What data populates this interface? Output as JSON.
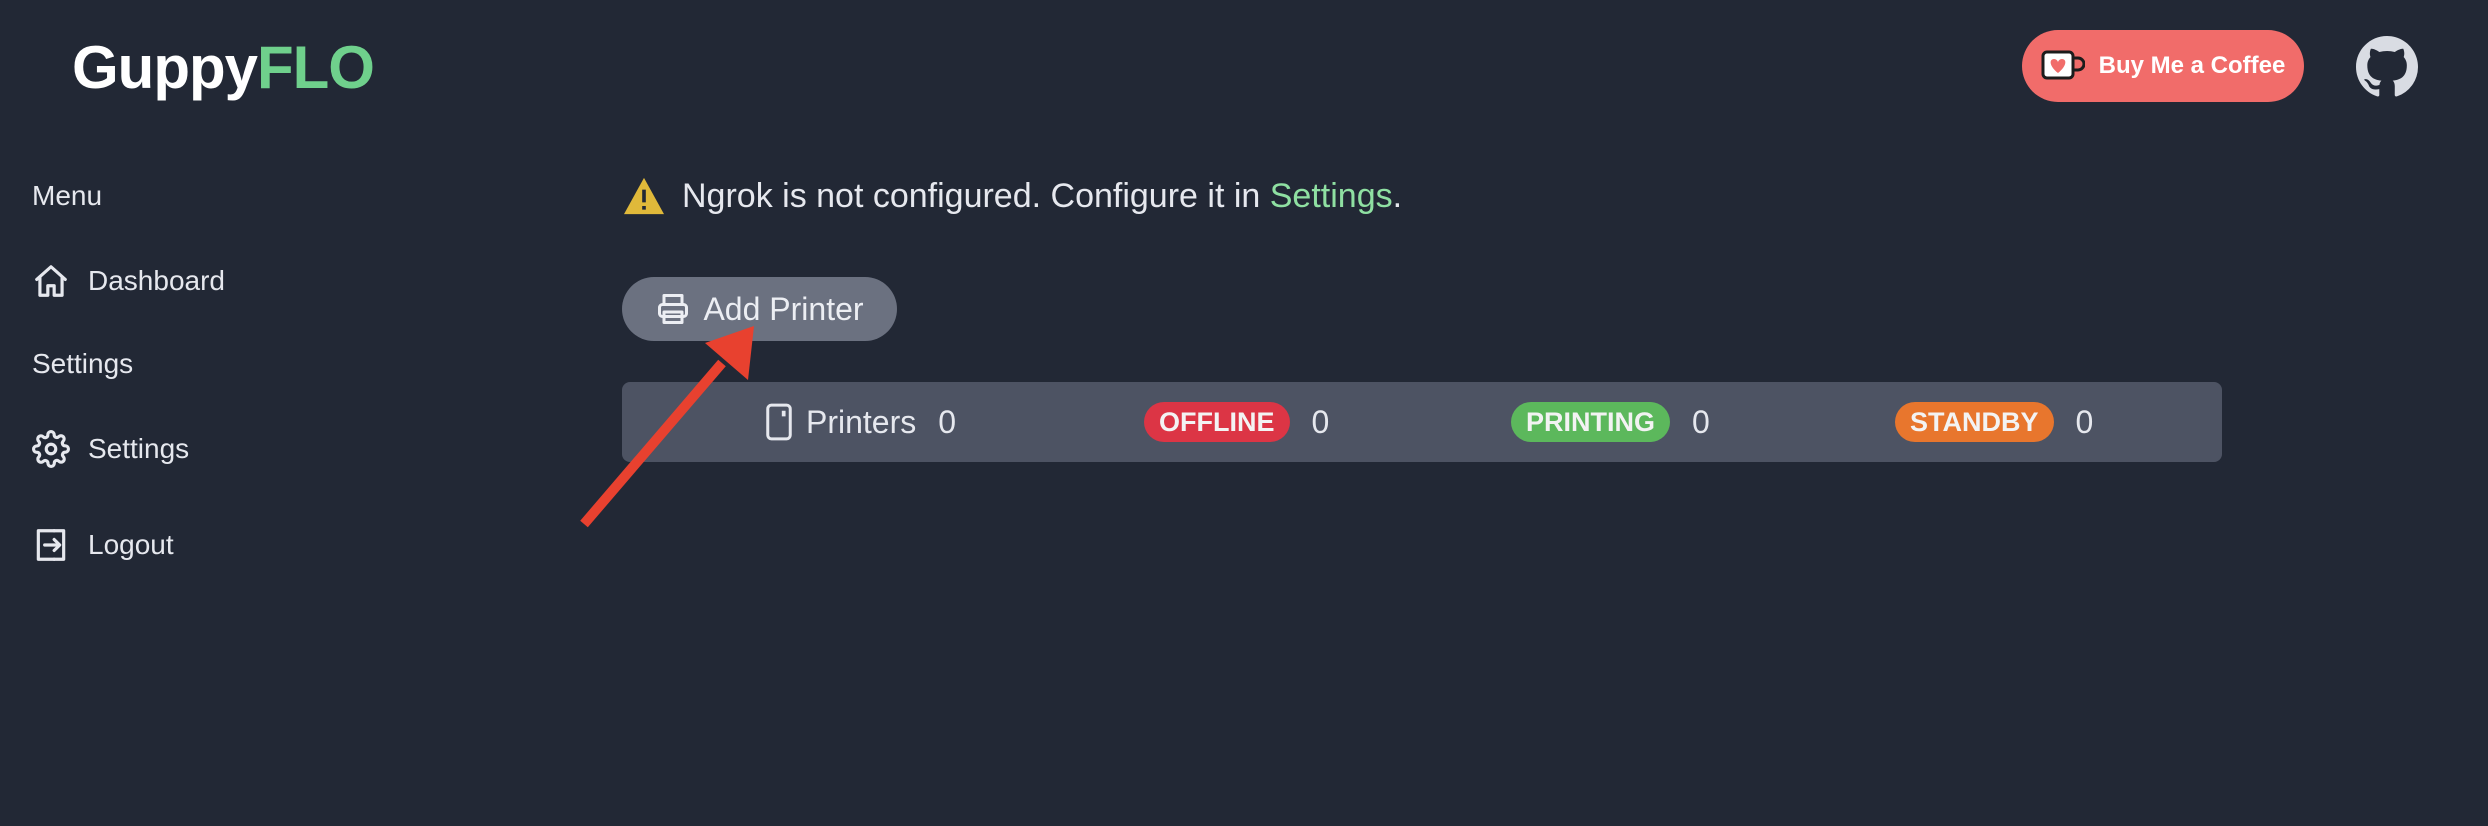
{
  "header": {
    "logo_part1": "Guppy",
    "logo_part2": "FLO",
    "donate_label": "Buy Me a Coffee",
    "github_icon": "github-icon"
  },
  "sidebar": {
    "menu_heading": "Menu",
    "settings_heading": "Settings",
    "items": [
      {
        "label": "Dashboard",
        "icon": "home-icon"
      },
      {
        "label": "Settings",
        "icon": "gear-icon"
      },
      {
        "label": "Logout",
        "icon": "logout-icon"
      }
    ]
  },
  "main": {
    "warning": {
      "icon": "warning-icon",
      "text": "Ngrok is not configured. Configure it in ",
      "link_text": "Settings",
      "suffix": "."
    },
    "add_printer_label": "Add Printer",
    "stats": {
      "printers_label": "Printers",
      "printers_count": "0",
      "offline_label": "OFFLINE",
      "offline_count": "0",
      "printing_label": "PRINTING",
      "printing_count": "0",
      "standby_label": "STANDBY",
      "standby_count": "0"
    }
  },
  "colors": {
    "background": "#222835",
    "accent_green": "#6fd08c",
    "donate_button": "#f16c6a",
    "offline": "#dc3545",
    "printing": "#5cb85c",
    "standby": "#e8762d",
    "annotation_arrow": "#e8412f"
  }
}
